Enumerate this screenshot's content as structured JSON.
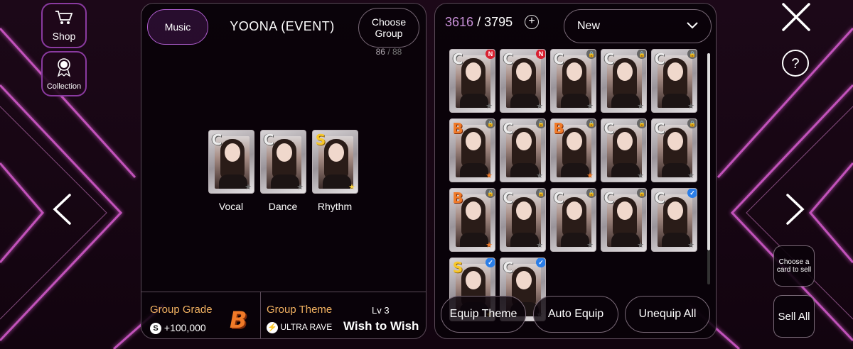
{
  "rail": {
    "shop_label": "Shop",
    "collection_label": "Collection"
  },
  "left_panel": {
    "music_label": "Music",
    "title": "YOONA (EVENT)",
    "choose_group_label": "Choose Group",
    "group_count_current": "86",
    "group_count_total": "88",
    "slots": [
      {
        "label": "Vocal",
        "grade": "C",
        "star": "grey"
      },
      {
        "label": "Dance",
        "grade": "C",
        "star": "grey"
      },
      {
        "label": "Rhythm",
        "grade": "S",
        "star": "gold"
      }
    ],
    "group_grade_label": "Group Grade",
    "group_grade_bonus": "+100,000",
    "group_grade_value": "B",
    "group_theme_label": "Group Theme",
    "theme_level": "Lv 3",
    "theme_brand": "ULTRA RAVE",
    "theme_name": "Wish to Wish"
  },
  "right_panel": {
    "owned_count": "3616",
    "total_count": "3795",
    "sort_value": "New",
    "cards": [
      {
        "grade": "C",
        "badge": "new",
        "star": "grey"
      },
      {
        "grade": "C",
        "badge": "new",
        "star": "grey"
      },
      {
        "grade": "C",
        "badge": "lock",
        "star": "grey"
      },
      {
        "grade": "C",
        "badge": "lock",
        "star": "grey"
      },
      {
        "grade": "C",
        "badge": "lock",
        "star": "grey"
      },
      {
        "grade": "B",
        "badge": "lock",
        "star": "orange"
      },
      {
        "grade": "C",
        "badge": "lock",
        "star": "grey"
      },
      {
        "grade": "B",
        "badge": "lock",
        "star": "orange"
      },
      {
        "grade": "C",
        "badge": "lock",
        "star": "grey"
      },
      {
        "grade": "C",
        "badge": "lock",
        "star": "grey"
      },
      {
        "grade": "B",
        "badge": "lock",
        "star": "orange"
      },
      {
        "grade": "C",
        "badge": "lock",
        "star": "grey"
      },
      {
        "grade": "C",
        "badge": "lock",
        "star": "grey"
      },
      {
        "grade": "C",
        "badge": "lock",
        "star": "grey"
      },
      {
        "grade": "C",
        "badge": "check",
        "star": "grey"
      },
      {
        "grade": "S",
        "badge": "check",
        "star": "gold"
      },
      {
        "grade": "C",
        "badge": "check",
        "star": "grey"
      }
    ],
    "equip_theme_label": "Equip Theme",
    "auto_equip_label": "Auto Equip",
    "unequip_all_label": "Unequip All"
  },
  "side": {
    "choose_sell_label": "Choose a card to sell",
    "sell_all_label": "Sell All"
  },
  "icons": {
    "close": "close-icon",
    "help": "help-icon",
    "prev": "chevron-left-icon",
    "next": "chevron-right-icon",
    "shop": "cart-icon",
    "collection": "medal-icon",
    "add": "plus-circle-icon",
    "dropdown": "chevron-down-icon"
  },
  "colors": {
    "accent": "#b05ed0",
    "owned_count": "#c890d8",
    "gold_label": "#f0b060",
    "grade_B": "#f07a28",
    "grade_S": "#f8c82a"
  }
}
